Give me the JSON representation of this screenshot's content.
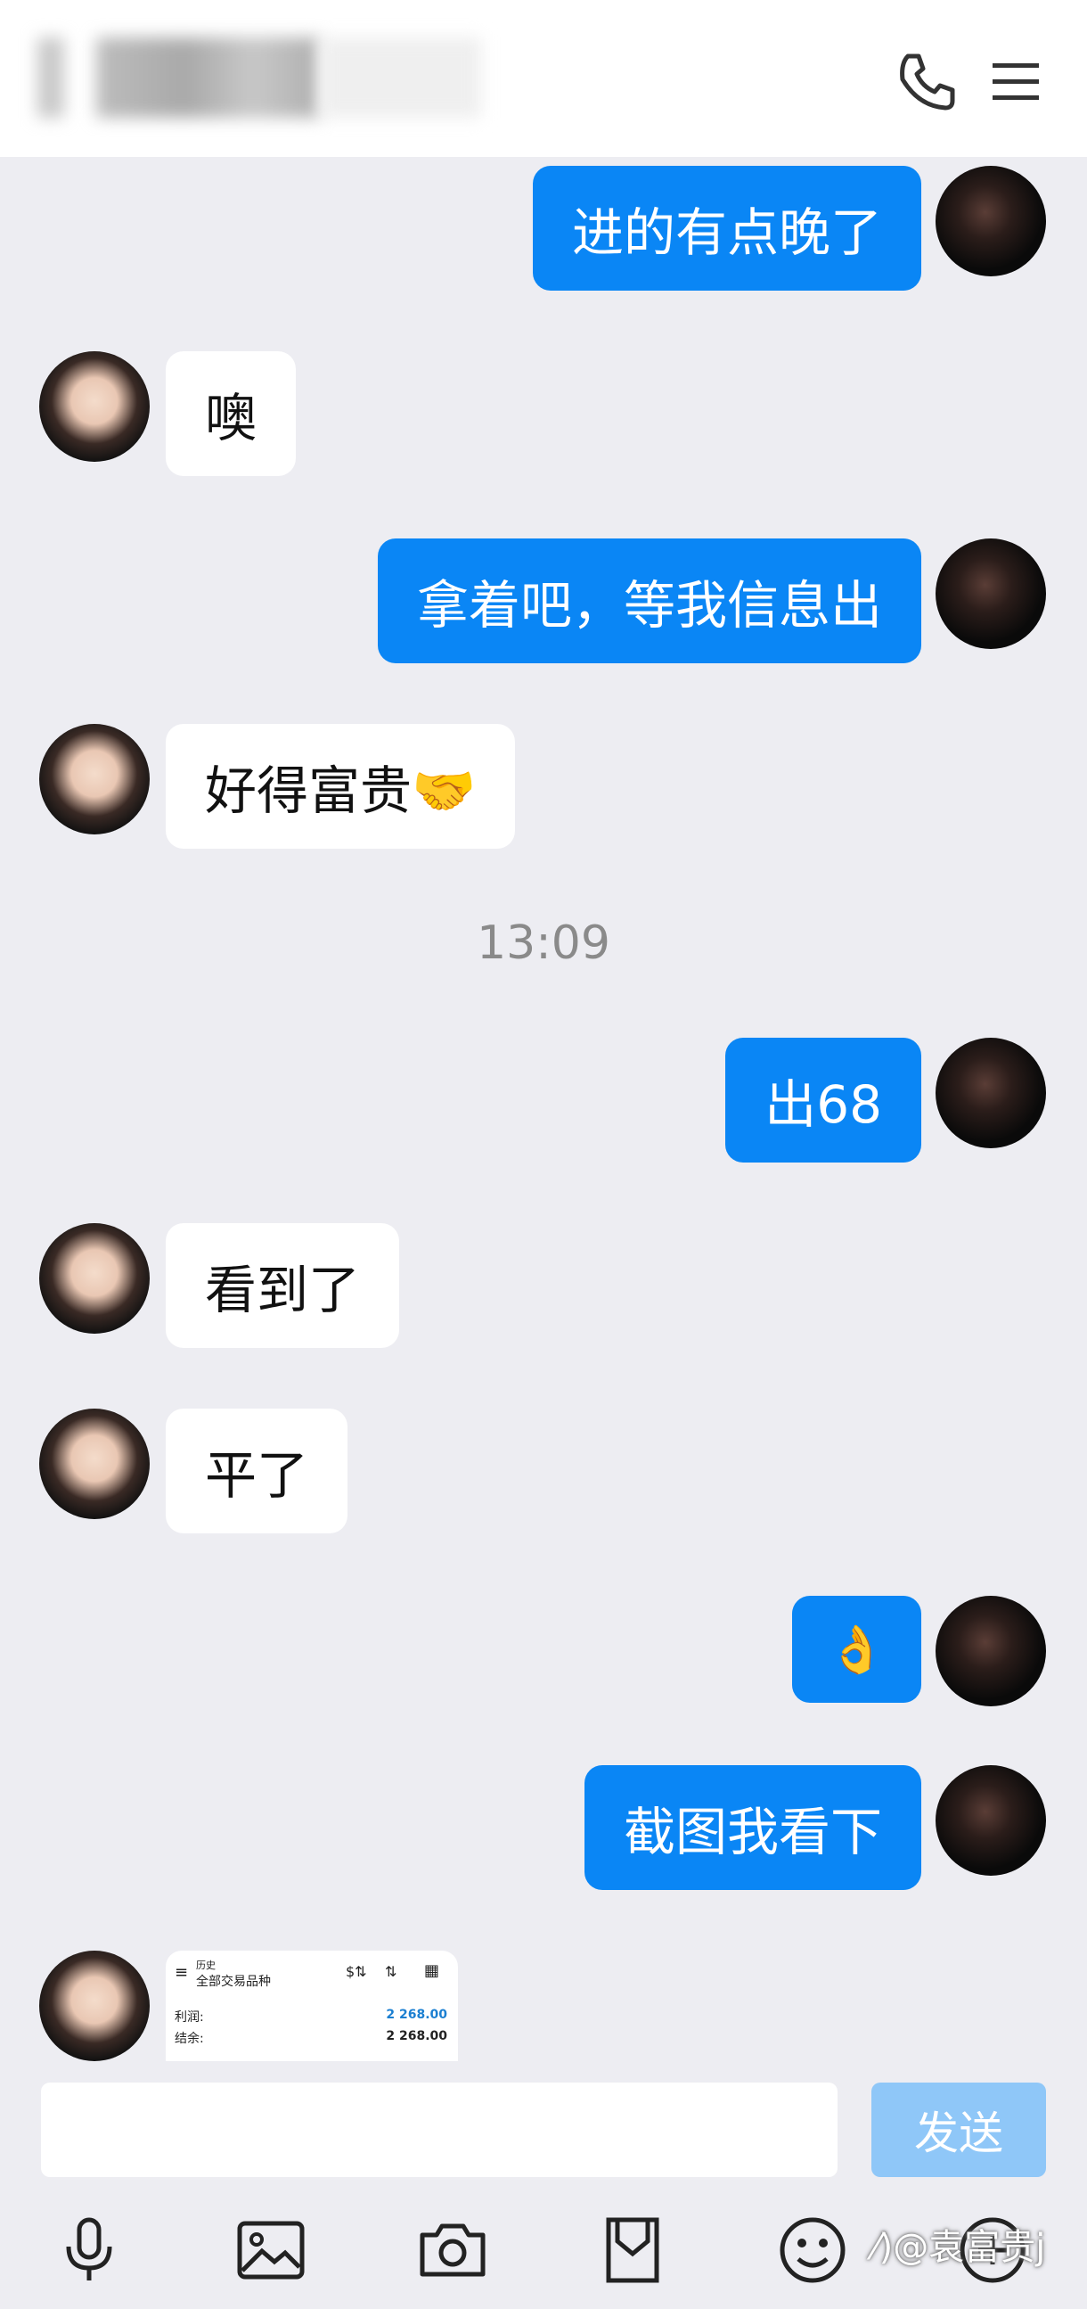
{
  "header": {
    "contact_name": "████████"
  },
  "messages": [
    {
      "from": "me",
      "text": "进的有点晚了"
    },
    {
      "from": "them",
      "text": "噢"
    },
    {
      "from": "me",
      "text": "拿着吧，等我信息出"
    },
    {
      "from": "them",
      "text": "好得富贵🤝"
    },
    {
      "timestamp": "13:09"
    },
    {
      "from": "me",
      "text": "出68"
    },
    {
      "from": "them",
      "text": "看到了"
    },
    {
      "from": "them",
      "text": "平了"
    },
    {
      "from": "me",
      "text": "👌"
    },
    {
      "from": "me",
      "text": "截图我看下"
    }
  ],
  "screenshot": {
    "header_small": "历史",
    "header_title": "全部交易品种",
    "rows": [
      {
        "label": "利润:",
        "value": "2 268.00",
        "value_color": "#1b7fd1"
      },
      {
        "label": "结余:",
        "value": "2 268.00",
        "value_color": "#111111"
      }
    ]
  },
  "composer": {
    "send_label": "发送"
  },
  "toolbar": [
    "microphone-icon",
    "image-icon",
    "camera-icon",
    "file-icon",
    "emoji-icon",
    "more-icon"
  ],
  "watermark": "⁄)@袁富贵j",
  "colors": {
    "my_bubble": "#0a86f5",
    "their_bubble": "#ffffff",
    "send_disabled": "#8fc7f8",
    "background": "#ededf2"
  }
}
